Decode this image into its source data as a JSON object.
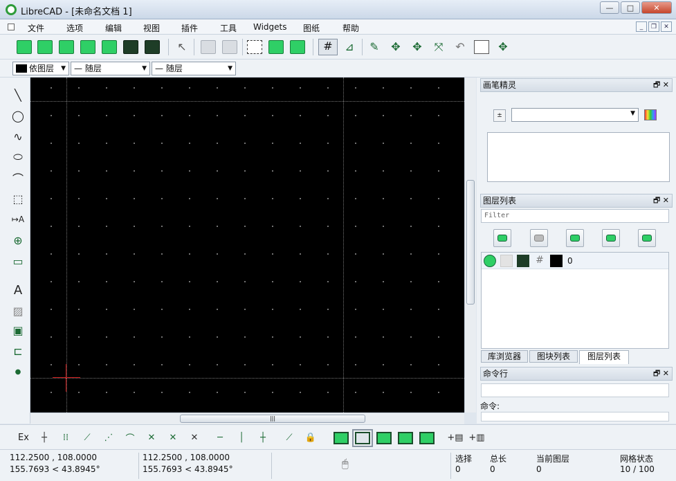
{
  "window": {
    "title": "LibreCAD - [未命名文档 1]",
    "min": "—",
    "max": "□",
    "close": "✕"
  },
  "menubar": {
    "items": [
      "文件",
      "选项",
      "编辑",
      "视图",
      "插件",
      "工具",
      "Widgets",
      "图纸",
      "帮助"
    ]
  },
  "layer_toolbar": {
    "color": "依图层",
    "width": "— 随层",
    "linetype": "— 随层"
  },
  "left_tools": {
    "text_tool": "A"
  },
  "pen_wizard": {
    "title": "画笔精灵",
    "controls": "🗗 ✕"
  },
  "layer_list": {
    "title": "图层列表",
    "controls": "🗗 ✕",
    "filter_placeholder": "Filter",
    "rows": [
      {
        "name": "0"
      }
    ]
  },
  "bottom_tabs": [
    "库浏览器",
    "图块列表",
    "图层列表"
  ],
  "command_line": {
    "title": "命令行",
    "controls": "🗗 ✕",
    "prompt": "命令:"
  },
  "snap_toolbar": {
    "ex": "Ex"
  },
  "status": {
    "coord_abs_1": "112.2500 , 108.0000",
    "coord_abs_2": "155.7693 < 43.8945°",
    "coord_rel_1": "112.2500 , 108.0000",
    "coord_rel_2": "155.7693 < 43.8945°",
    "selection_label": "选择",
    "selection_value": "0",
    "total_length_label": "总长",
    "total_length_value": "0",
    "current_layer_label": "当前图层",
    "current_layer_value": "0",
    "grid_label": "网格状态",
    "grid_value": "10 / 100"
  },
  "colors": {
    "icon_green": "#2fcf66",
    "crosshair": "#d21e1e",
    "canvas": "#000000"
  }
}
